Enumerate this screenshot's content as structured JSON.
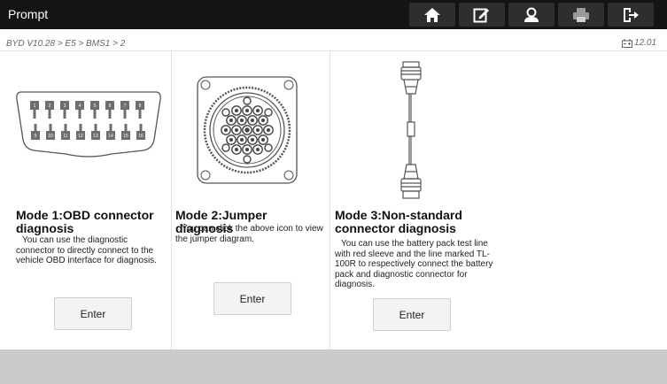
{
  "header": {
    "title": "Prompt",
    "icons": [
      "home-icon",
      "edit-icon",
      "user-icon",
      "print-icon",
      "exit-icon"
    ]
  },
  "breadcrumb": "BYD V10.28 > E5 > BMS1 > 2",
  "battery": {
    "value": "12.01"
  },
  "modes": [
    {
      "title": "Mode 1:OBD connector diagnosis",
      "description": "You can use the diagnostic connector to directly connect to the vehicle OBD interface for diagnosis.",
      "button": "Enter",
      "pins": [
        "1",
        "2",
        "3",
        "4",
        "5",
        "6",
        "7",
        "8",
        "9",
        "10",
        "11",
        "12",
        "13",
        "14",
        "15",
        "16"
      ]
    },
    {
      "title": "Mode 2:Jumper diagnosis",
      "description": "You can click the above icon to view the jumper diagram.",
      "button": "Enter"
    },
    {
      "title": "Mode 3:Non-standard connector diagnosis",
      "description": "You can use the battery pack test line with red sleeve and the line marked TL-100R to respectively connect the battery pack and diagnostic connector for diagnosis.",
      "button": "Enter"
    }
  ],
  "colors": {
    "topbar": "#141414",
    "button_bg": "#2e2e2e",
    "footer": "#cbcbcb"
  }
}
